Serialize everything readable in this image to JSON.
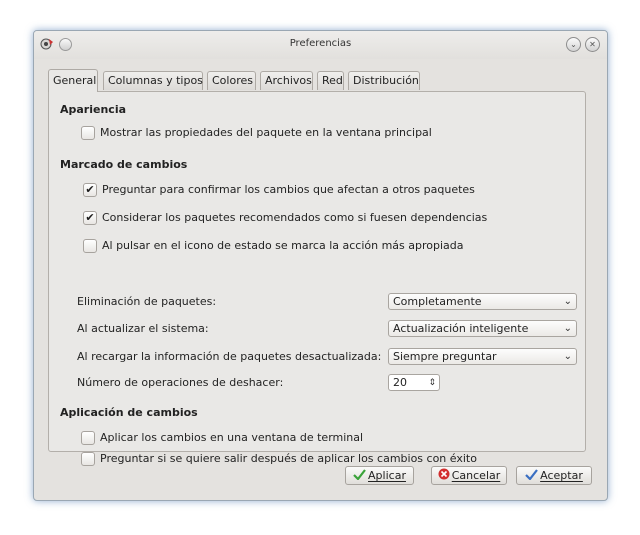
{
  "window": {
    "title": "Preferencias"
  },
  "tabs": [
    {
      "label": "General",
      "active": true
    },
    {
      "label": "Columnas y tipos",
      "active": false
    },
    {
      "label": "Colores",
      "active": false
    },
    {
      "label": "Archivos",
      "active": false
    },
    {
      "label": "Red",
      "active": false
    },
    {
      "label": "Distribución",
      "active": false
    }
  ],
  "apariencia": {
    "title": "Apariencia",
    "show_properties": {
      "label": "Mostrar las propiedades del paquete en la ventana principal",
      "checked": false
    }
  },
  "marcado": {
    "title": "Marcado de cambios",
    "confirm_changes": {
      "label": "Preguntar para confirmar los cambios que afectan a otros paquetes",
      "checked": true
    },
    "recommended_deps": {
      "label": "Considerar los paquetes recomendados como si fuesen dependencias",
      "checked": true
    },
    "status_icon": {
      "label": "Al pulsar en el icono de estado se marca la acción más apropiada",
      "checked": false
    },
    "removal": {
      "label": "Eliminación de paquetes:",
      "value": "Completamente"
    },
    "upgrade": {
      "label": "Al actualizar el sistema:",
      "value": "Actualización inteligente"
    },
    "reload": {
      "label": "Al recargar la información de paquetes desactualizada:",
      "value": "Siempre preguntar"
    },
    "undo": {
      "label": "Número de operaciones de deshacer:",
      "value": "20"
    }
  },
  "aplicacion": {
    "title": "Aplicación de cambios",
    "terminal": {
      "label": "Aplicar los cambios en una ventana de terminal",
      "checked": false
    },
    "ask_quit": {
      "label": "Preguntar si se quiere salir después de aplicar los cambios con éxito",
      "checked": false
    }
  },
  "buttons": {
    "apply": "Aplicar",
    "cancel": "Cancelar",
    "accept": "Aceptar"
  },
  "colors": {
    "check_green": "#3aa33a",
    "cancel_red": "#d22e2e",
    "accept_blue": "#3a6fc2",
    "window_glow": "#3c6eaa"
  }
}
